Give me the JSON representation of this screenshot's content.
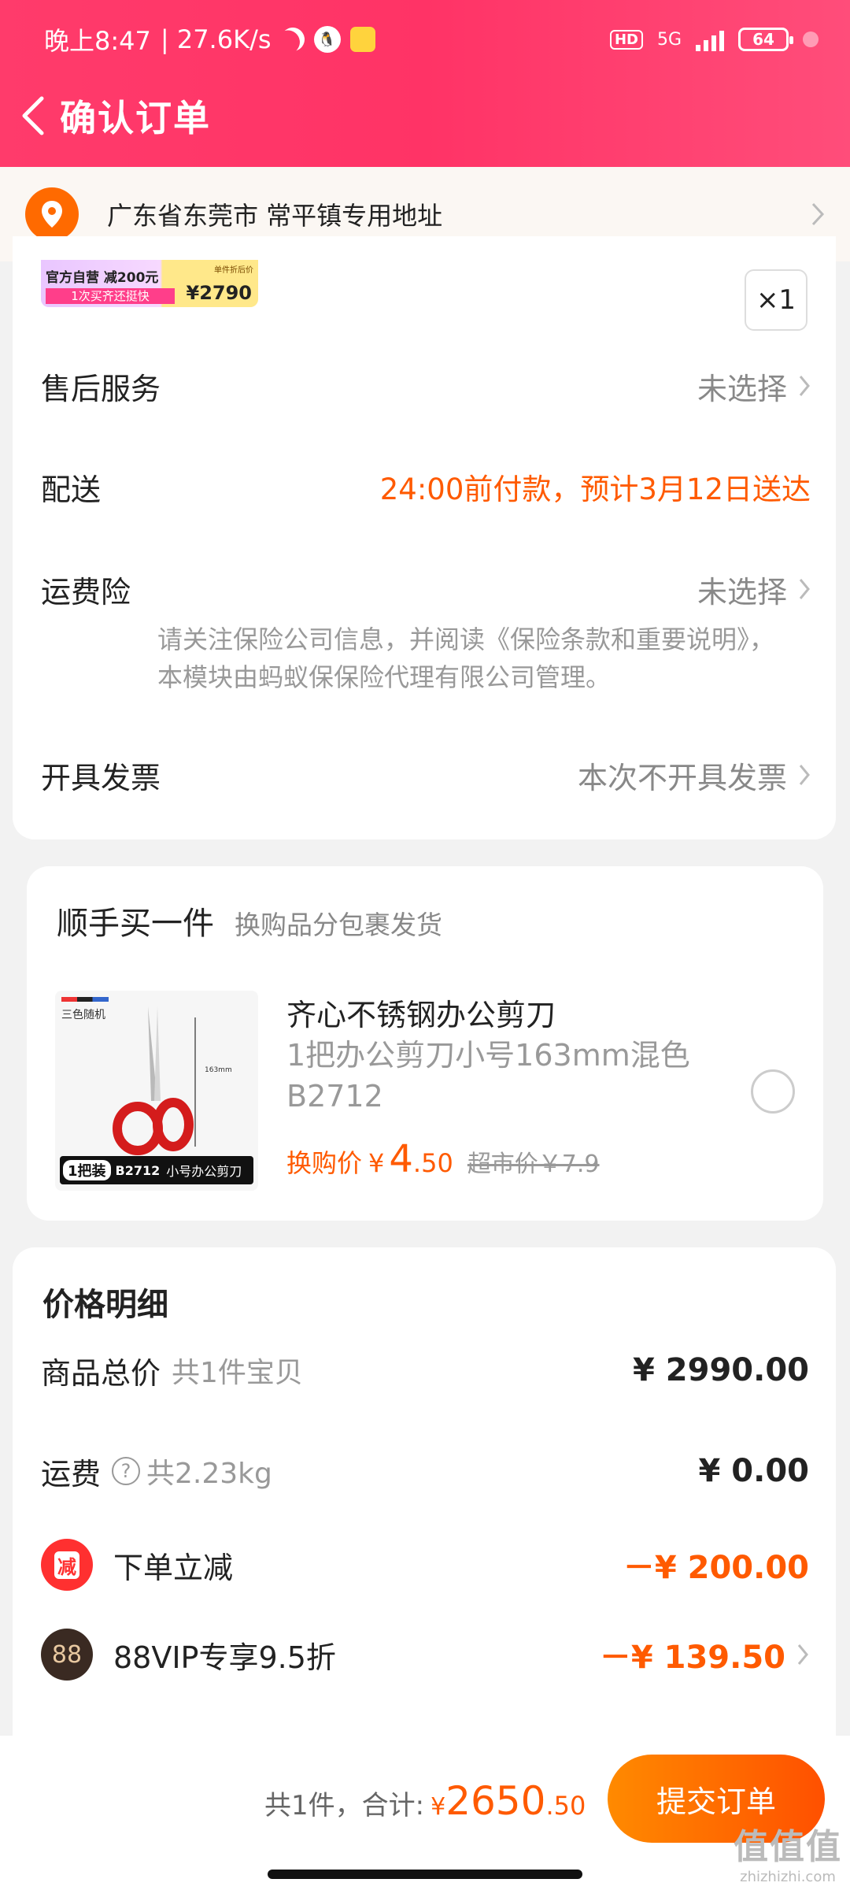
{
  "status_bar": {
    "time": "晚上8:47",
    "net_speed": "| 27.6K/s",
    "network": "5G",
    "battery": "64",
    "hd": "HD",
    "qq_icon": "qq-icon",
    "moon_icon": "moon-icon"
  },
  "header": {
    "title": "确认订单"
  },
  "address": {
    "text": "广东省东莞市 常平镇专用地址"
  },
  "item": {
    "promo_line1": "官方自营 减200元",
    "promo_line2": "1次买齐还挺快",
    "promo_small": "单件折后价",
    "promo_price": "¥2790",
    "quantity": "×1"
  },
  "options": {
    "after_sales": {
      "label": "售后服务",
      "value": "未选择"
    },
    "delivery": {
      "label": "配送",
      "value": "24:00前付款，预计3月12日送达"
    },
    "shipping_insurance": {
      "label": "运费险",
      "value": "未选择",
      "note": "请关注保险公司信息，并阅读《保险条款和重要说明》，本模块由蚂蚁保保险代理有限公司管理。"
    },
    "invoice": {
      "label": "开具发票",
      "value": "本次不开具发票"
    }
  },
  "addon": {
    "title": "顺手买一件",
    "subtitle": "换购品分包裹发货",
    "product": {
      "name": "齐心不锈钢办公剪刀",
      "spec": "1把办公剪刀小号163mm混色B2712",
      "price_label": "换购价",
      "currency": "¥",
      "price_int": "4",
      "price_dec": ".50",
      "market_price": "超市价￥7.9",
      "img_tag": "三色随机",
      "img_size": "163mm",
      "img_badge": "1把装",
      "img_code": "B2712",
      "img_caption": "小号办公剪刀"
    }
  },
  "price_detail": {
    "title": "价格明细",
    "goods_total": {
      "label": "商品总价",
      "sub": "共1件宝贝",
      "amount": "¥ 2990.00"
    },
    "shipping": {
      "label": "运费",
      "sub": "共2.23kg",
      "amount": "¥ 0.00"
    },
    "discount": {
      "badge": "减",
      "label": "下单立减",
      "amount": "－¥ 200.00"
    },
    "vip": {
      "badge": "88",
      "label": "88VIP专享9.5折",
      "amount": "－¥ 139.50"
    }
  },
  "footer": {
    "summary": "共1件，合计:",
    "currency": "¥",
    "total_int": "2650",
    "total_dec": ".50",
    "submit_label": "提交订单"
  },
  "watermark": {
    "line1": "值值值",
    "line2": "zhizhizhi.com"
  },
  "colors": {
    "header": "#ff3366",
    "accent": "#ff5a00",
    "location": "#ff6a00"
  }
}
